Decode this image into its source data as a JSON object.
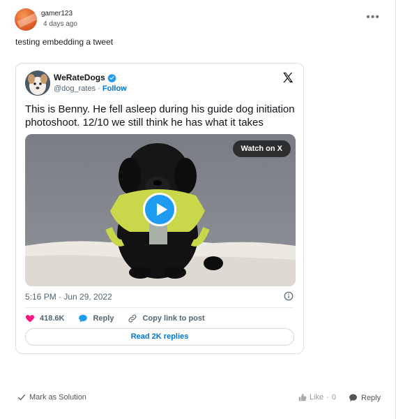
{
  "post": {
    "username": "gamer123",
    "time": "4 days ago",
    "more_icon": "ellipsis-icon",
    "body": "testing embedding a tweet"
  },
  "tweet": {
    "author_name": "WeRateDogs",
    "handle": "@dog_rates",
    "separator": "·",
    "follow_label": "Follow",
    "text": "This is Benny. He fell asleep during his guide dog initiation photoshoot. 12/10 we still think he has what it takes",
    "watch_label": "Watch on X",
    "date": "5:16 PM · Jun 29, 2022",
    "likes": "418.6K",
    "reply_label": "Reply",
    "copy_label": "Copy link to post",
    "read_replies_label": "Read 2K replies",
    "colors": {
      "accent": "#1d9bf0",
      "link": "#0074d3",
      "like": "#f91880"
    }
  },
  "footer": {
    "solution_label": "Mark as Solution",
    "like_label": "Like",
    "like_separator": "·",
    "like_count": "0",
    "reply_label": "Reply"
  }
}
